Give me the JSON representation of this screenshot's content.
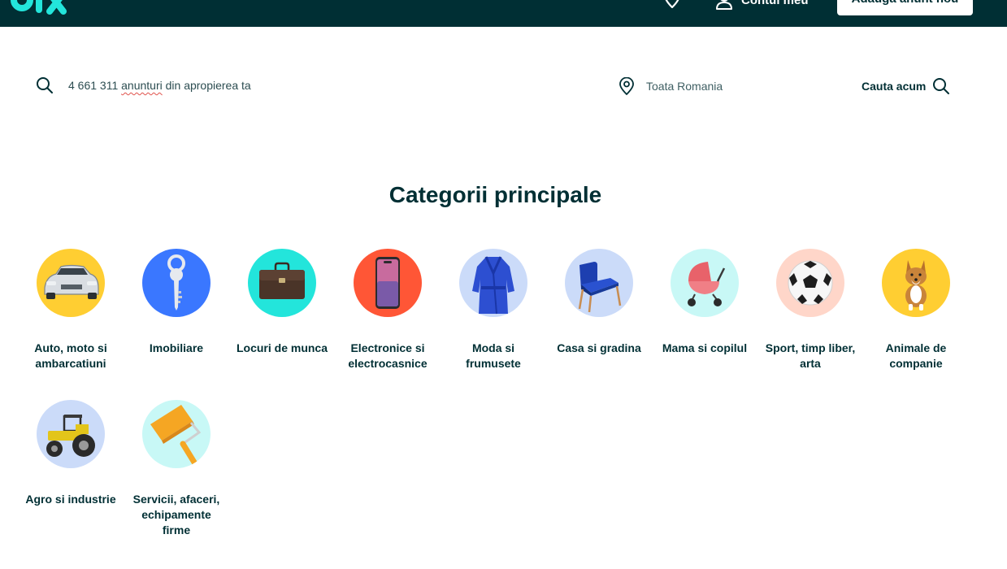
{
  "header": {
    "account_label": "Contul meu",
    "post_button_label": "Adauga anunt nou"
  },
  "search": {
    "query_prefix": "4 661 311 ",
    "query_flagged": "anunturi",
    "query_suffix": " din apropierea ta",
    "location": "Toata Romania",
    "button_label": "Cauta acum"
  },
  "categories_section": {
    "title": "Categorii principale",
    "items": [
      {
        "label": "Auto, moto si ambarcatiuni",
        "icon": "car-icon",
        "color": "#ffce32"
      },
      {
        "label": "Imobiliare",
        "icon": "key-icon",
        "color": "#3a77ff"
      },
      {
        "label": "Locuri de munca",
        "icon": "briefcase-icon",
        "color": "#23e5db"
      },
      {
        "label": "Electronice si electrocasnice",
        "icon": "smartphone-icon",
        "color": "#ff5636"
      },
      {
        "label": "Moda si frumusete",
        "icon": "robe-icon",
        "color": "#cbdbf9"
      },
      {
        "label": "Casa si gradina",
        "icon": "armchair-icon",
        "color": "#cbdbf9"
      },
      {
        "label": "Mama si copilul",
        "icon": "stroller-icon",
        "color": "#c8f8f6"
      },
      {
        "label": "Sport, timp liber, arta",
        "icon": "football-icon",
        "color": "#ffd6c9"
      },
      {
        "label": "Animale de companie",
        "icon": "dog-icon",
        "color": "#ffce32"
      },
      {
        "label": "Agro si industrie",
        "icon": "tractor-icon",
        "color": "#cbdbf9"
      },
      {
        "label": "Servicii, afaceri, echipamente firme",
        "icon": "paint-roller-icon",
        "color": "#c8f8f6"
      }
    ]
  },
  "colors": {
    "header_bg": "#002f34",
    "text": "#002f34",
    "accent": "#23e5db"
  }
}
